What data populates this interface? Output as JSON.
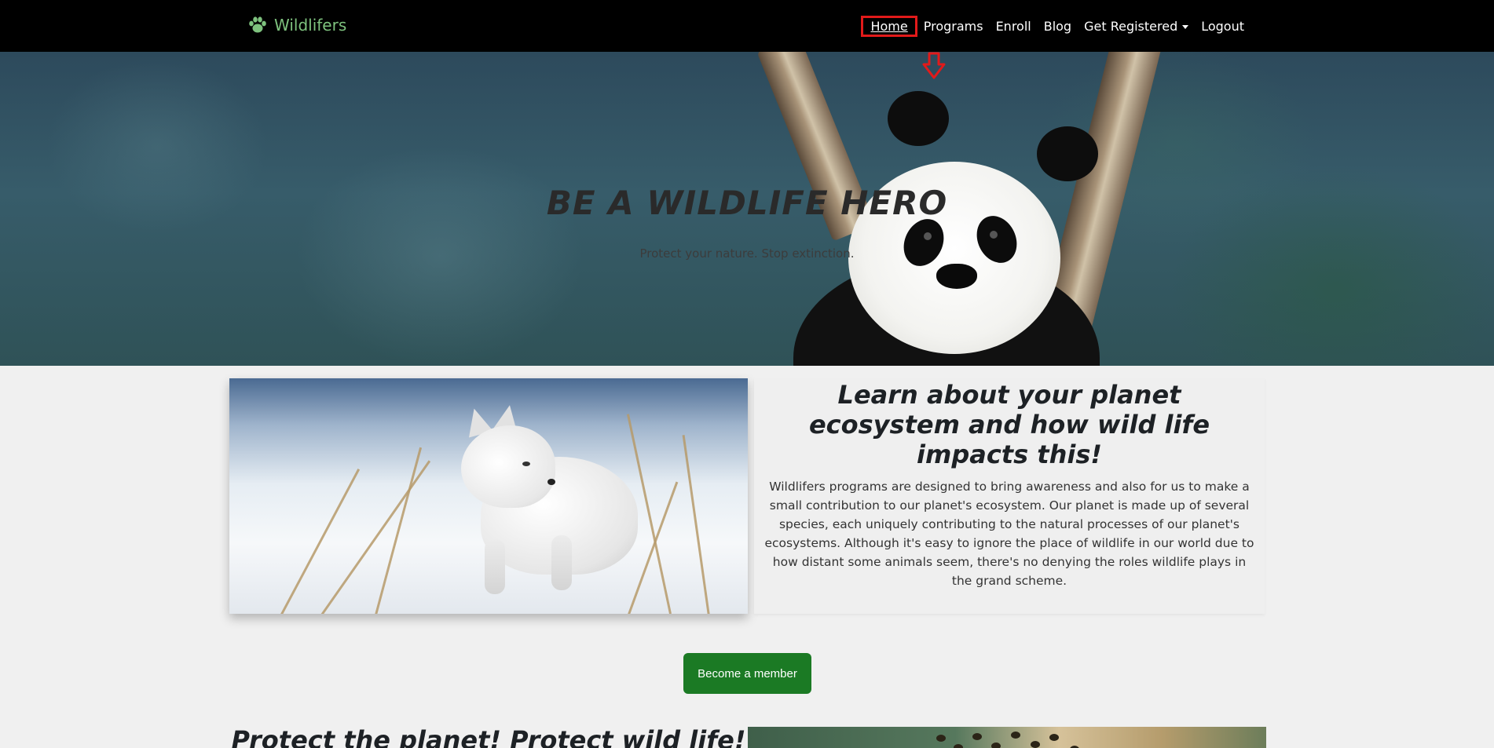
{
  "navbar": {
    "brand": "Wildlifers",
    "brand_icon": "paw-icon",
    "links": {
      "home": "Home",
      "programs": "Programs",
      "enroll": "Enroll",
      "blog": "Blog",
      "get_registered": "Get Registered",
      "logout": "Logout"
    }
  },
  "hero": {
    "title": "BE A WILDLIFE HERO",
    "subtitle": "Protect your nature. Stop extinction."
  },
  "section_learn": {
    "title": "Learn about your planet ecosystem and how wild life impacts this!",
    "body": "Wildlifers programs are designed to bring awareness and also for us to make a small contribution to our planet's ecosystem. Our planet is made up of several species, each uniquely contributing to the natural processes of our planet's ecosystems. Although it's easy to ignore the place of wildlife in our world due to how distant some animals seem, there's no denying the roles wildlife plays in the grand scheme."
  },
  "cta": {
    "member_button": "Become a member"
  },
  "section_protect": {
    "title": "Protect the planet! Protect wild life!"
  },
  "colors": {
    "brand": "#7ec27e",
    "button": "#1b7a24",
    "highlight": "#e21a1a",
    "navbar": "#000000"
  }
}
